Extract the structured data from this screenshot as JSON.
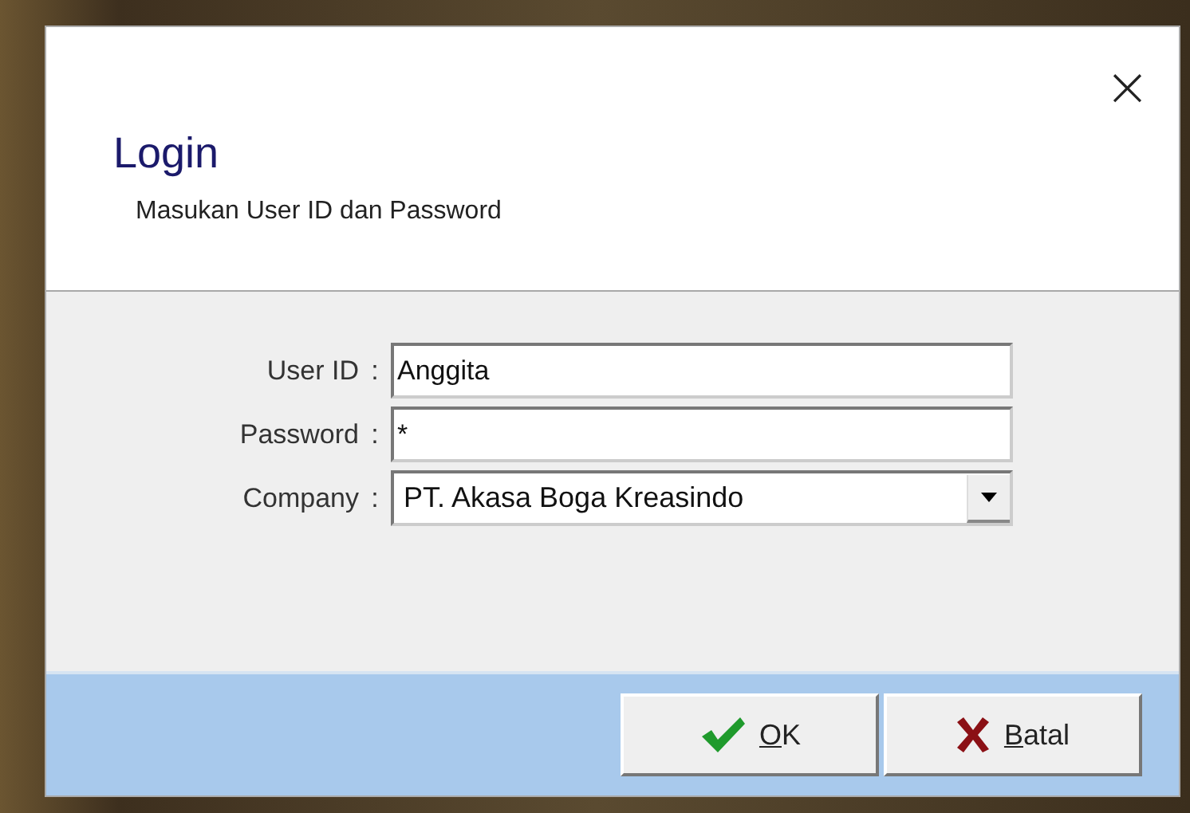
{
  "dialog": {
    "close_glyph": "×",
    "title": "Login",
    "subtitle": "Masukan User ID dan Password"
  },
  "fields": [
    {
      "kind": "text",
      "label": "User ID",
      "colon": ":",
      "value": "Anggita"
    },
    {
      "kind": "text",
      "label": "Password",
      "colon": ":",
      "value": "*"
    },
    {
      "kind": "dropdown",
      "label": "Company",
      "colon": ":",
      "value": "PT. Akasa Boga Kreasindo"
    }
  ],
  "buttons": [
    {
      "kind": "ok",
      "label": "OK",
      "first_letter_underlined": true
    },
    {
      "kind": "cancel",
      "label": "Batal",
      "first_letter_underlined": true
    }
  ]
}
